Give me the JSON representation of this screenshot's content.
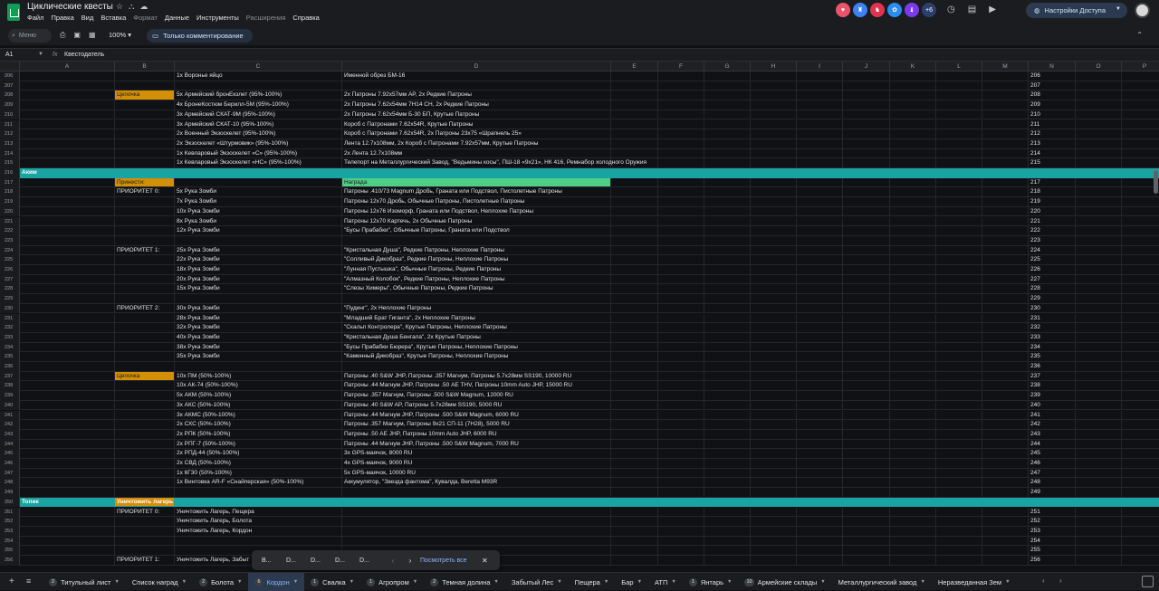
{
  "title": "Циклические квесты",
  "menus": [
    "Файл",
    "Правка",
    "Вид",
    "Вставка",
    "Формат",
    "Данные",
    "Инструменты",
    "Расширения",
    "Справка"
  ],
  "menus_dim": [
    "Формат",
    "Расширения"
  ],
  "collab_extra": "+6",
  "share_label": "Настройки Доступа",
  "toolbar": {
    "search_placeholder": "Меню",
    "zoom": "100%",
    "mode_label": "Только комментирование"
  },
  "formula": {
    "cell_ref": "A1",
    "fx": "fx",
    "value": "Квестодатель"
  },
  "columns": [
    {
      "l": "A",
      "w": 105
    },
    {
      "l": "B",
      "w": 66
    },
    {
      "l": "C",
      "w": 185
    },
    {
      "l": "D",
      "w": 297
    },
    {
      "l": "E",
      "w": 52
    },
    {
      "l": "F",
      "w": 51
    },
    {
      "l": "G",
      "w": 51
    },
    {
      "l": "H",
      "w": 51
    },
    {
      "l": "I",
      "w": 51
    },
    {
      "l": "J",
      "w": 52
    },
    {
      "l": "K",
      "w": 51
    },
    {
      "l": "L",
      "w": 51
    },
    {
      "l": "M",
      "w": 51
    },
    {
      "l": "N",
      "w": 52
    },
    {
      "l": "O",
      "w": 51
    },
    {
      "l": "P",
      "w": 51
    }
  ],
  "rows": [
    {
      "n": "206",
      "c": "1х Воронье яйцо",
      "d": "Именной обрез БМ-16"
    },
    {
      "n": "207"
    },
    {
      "n": "208",
      "b": "Цепочка",
      "b_tag": "orange",
      "c": "5х Армейский бронЕкзлет (95%-100%)",
      "d": "2х Патроны 7.92х57мм AP, 2х Редкие Патроны"
    },
    {
      "n": "209",
      "c": "4х БронеКостюм Берилл-5М (95%-100%)",
      "d": "2х Патроны 7.62х54мм 7Н14 СН, 2х Редкие Патроны"
    },
    {
      "n": "210",
      "c": "3х Армейский СКАТ-9М (95%-100%)",
      "d": " 2х Патроны 7.62х54мм Б-30 БП, Крутые Патроны"
    },
    {
      "n": "211",
      "c": "3х Армейский СКАТ-10 (95%-100%)",
      "d": " Короб с Патронами 7.62х54R, Крутые Патроны"
    },
    {
      "n": "212",
      "c": "2х Военный Экзоскелет (95%-100%)",
      "d": "Короб с Патронами 7.62х54R, 2х Патроны 23х75 «Шрапнель 25»"
    },
    {
      "n": "213",
      "c": "2х Экзоскелет «Штурмовик» (95%-100%)",
      "d": "Лента 12.7х108мм, 2х Короб с Патронами 7.92х57мм, Крутые Патроны"
    },
    {
      "n": "214",
      "c": "1х Кевларовый Экзоскелет «С» (95%-100%)",
      "d": " 2х Лента 12.7х108мм"
    },
    {
      "n": "215",
      "c": "1х Кевларовый Экзоскелет «НС» (95%-100%)",
      "d": "Телепорт на Металлургический Завод, \"Ведьмины косы\", ПШ-18 «9х21», НК 416, Ремнабор холодного Оружия"
    },
    {
      "n": "216",
      "header": true,
      "a": "Аким"
    },
    {
      "n": "217",
      "b": "Принести:",
      "b_tag": "orange",
      "d": "Награда",
      "d_tag": "green"
    },
    {
      "n": "218",
      "b": "ПРИОРИТЕТ 0:",
      "c": "5х Рука Зомби",
      "d": "Патроны .410/73 Magnum Дробь, Граната или Подствол, Пистолетные Патроны"
    },
    {
      "n": "219",
      "c": "7х Рука Зомби",
      "d": "Патроны 12х70 Дробь, Обычные Патроны, Пистолетные Патроны"
    },
    {
      "n": "220",
      "c": "10х Рука Зомби",
      "d": "Патроны 12х76 Изоморф, Граната или Подствол, Неплохие Патроны"
    },
    {
      "n": "221",
      "c": "8х Рука Зомби",
      "d": "Патроны 12х70 Картечь, 2х Обычные Патроны"
    },
    {
      "n": "222",
      "c": "12х Рука Зомби",
      "d": "\"Бусы Прабабки\", Обычные Патроны, Граната или Подствол"
    },
    {
      "n": "223"
    },
    {
      "n": "224",
      "b": "ПРИОРИТЕТ 1:",
      "c": "25х Рука Зомби",
      "d": "\"Кристальная Душа\", Редкие Патроны, Неплохие Патроны"
    },
    {
      "n": "225",
      "c": "22х Рука Зомби",
      "d": "\"Солливый Дикобраз\", Редкие Патроны, Неплохие Патроны"
    },
    {
      "n": "226",
      "c": "18х Рука Зомби",
      "d": "\"Лунная Пустышка\", Обычные Патроны, Редкие Патроны"
    },
    {
      "n": "227",
      "c": "20х Рука Зомби",
      "d": " \"Алмазный Колобок\", Редкие Патроны, Неплохие Патроны"
    },
    {
      "n": "228",
      "c": "15х Рука Зомби",
      "d": " \"Слезы Химеры\", Обычные Патроны, Редкие Патроны"
    },
    {
      "n": "229"
    },
    {
      "n": "230",
      "b": "ПРИОРИТЕТ 2:",
      "c": "30х Рука Зомби",
      "d": "\"Пудинг\", 2х Неплохие Патроны"
    },
    {
      "n": "231",
      "c": "28х Рука Зомби",
      "d": "\"Младший Брат Гиганта\", 2х Неплохие Патроны"
    },
    {
      "n": "232",
      "c": "32х Рука Зомби",
      "d": " \"Скальп Контролера\", Крутые Патроны, Неплохие Патроны"
    },
    {
      "n": "233",
      "c": "40х Рука Зомби",
      "d": " \"Кристальная Душа Бенгала\", 2х Крутые Патроны"
    },
    {
      "n": "234",
      "c": "38х Рука Зомби",
      "d": "\"Бусы Прабабки Бюрера\", Крутые Патроны, Неплохие Патроны"
    },
    {
      "n": "235",
      "c": "35х Рука Зомби",
      "d": " \"Каменный Дикобраз\", Крутые Патроны, Неплохие Патроны"
    },
    {
      "n": "236"
    },
    {
      "n": "237",
      "b": "Цепочка",
      "b_tag": "orange",
      "c": "10х ПМ (50%-100%)",
      "d": "Патроны .40 S&W JHP, Патроны .357 Магнум, Патроны 5.7х28мм SS190, 10000 RU"
    },
    {
      "n": "238",
      "c": "10х АК-74 (50%-100%)",
      "d": "Патроны .44 Магнум JHP, Патроны .50 AE THV, Патроны 10mm Auto JHP, 15000 RU"
    },
    {
      "n": "239",
      "c": "5х АКМ (50%-100%)",
      "d": "Патроны .357 Магнум, Патроны .500 S&W Magnum, 12000 RU"
    },
    {
      "n": "240",
      "c": "3х АКС (50%-100%)",
      "d": "Патроны .40 S&W AP, Патроны 5.7х28мм SS190, 5000 RU"
    },
    {
      "n": "241",
      "c": "3х АКМС (50%-100%)",
      "d": " Патроны .44 Магнум JHP, Патроны .500 S&W Magnum, 6000 RU"
    },
    {
      "n": "242",
      "c": "2х СХС (50%-100%)",
      "d": " Патроны .357 Магнум, Патроны 9х21 СП-11 (7Н28), 5000 RU"
    },
    {
      "n": "243",
      "c": "2х РПК (50%-100%)",
      "d": "Патроны .50 AE JHP, Патроны 10mm Auto JHP, 6000 RU"
    },
    {
      "n": "244",
      "c": "2х РПГ-7 (50%-100%)",
      "d": "Патроны .44 Магнум JHP, Патроны .500 S&W Magnum, 7000 RU"
    },
    {
      "n": "245",
      "c": "2х РПД-44 (50%-100%)",
      "d": "3х GPS-маячок, 8000 RU"
    },
    {
      "n": "246",
      "c": "2х СВД (50%-100%)",
      "d": "4х GPS-маячок, 9000 RU"
    },
    {
      "n": "247",
      "c": "1х 6Г30 (50%-100%)",
      "d": " 5х GPS-маячок, 10000 RU"
    },
    {
      "n": "248",
      "c": "1х Винтовка AR-F «Снайперская» (50%-100%)",
      "d": " Аккумулятор, \"Звезда фантома\", Кувалда, Beretta M93R"
    },
    {
      "n": "249"
    },
    {
      "n": "250",
      "header": true,
      "a": "Топик",
      "b": "Уничтожить лагерь",
      "b_tag": "orange"
    },
    {
      "n": "251",
      "b": "ПРИОРИТЕТ 0:",
      "c": "Уничтожить Лагерь, Пещера"
    },
    {
      "n": "252",
      "c": "Уничтожить Лагерь, Болота"
    },
    {
      "n": "253",
      "c": "Уничтожить Лагерь, Кордон"
    },
    {
      "n": "254"
    },
    {
      "n": "255"
    },
    {
      "n": "256",
      "b": "ПРИОРИТЕТ 1:",
      "c": "Уничтожить Лагерь, Забыт"
    }
  ],
  "find_bar": {
    "items": [
      "B...",
      "D...",
      "D...",
      "D...",
      "D..."
    ],
    "see_all": "Посмотреть все"
  },
  "tabs": [
    {
      "badge": "2",
      "label": "Титульный лист"
    },
    {
      "badge": "",
      "label": "Список наград"
    },
    {
      "badge": "2",
      "label": "Болота"
    },
    {
      "badge": "6",
      "label": "Кордон",
      "active": true
    },
    {
      "badge": "1",
      "label": "Свалка"
    },
    {
      "badge": "1",
      "label": "Агропром"
    },
    {
      "badge": "2",
      "label": "Темная долина"
    },
    {
      "badge": "",
      "label": "Забытый Лес"
    },
    {
      "badge": "",
      "label": "Пещера"
    },
    {
      "badge": "",
      "label": "Бар"
    },
    {
      "badge": "",
      "label": "АТП"
    },
    {
      "badge": "1",
      "label": "Янтарь"
    },
    {
      "badge": "10",
      "label": "Армейские склады"
    },
    {
      "badge": "",
      "label": "Металлургический завод"
    },
    {
      "badge": "",
      "label": "Неразведанная Зем"
    }
  ],
  "colors": {
    "header_teal": "#1aa3a3",
    "tag_orange": "#d38f06",
    "tag_green": "#4fce86",
    "active_tab": "#8ab4f8"
  }
}
